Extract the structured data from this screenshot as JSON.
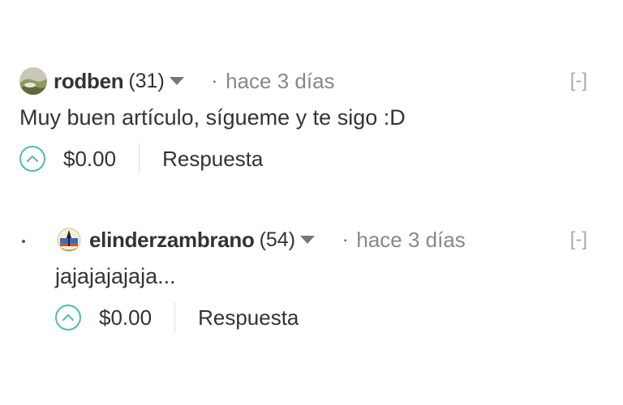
{
  "comments": [
    {
      "author": "rodben",
      "reputation": "(31)",
      "separator": "·",
      "timestamp": "hace 3 días",
      "collapse": "[-]",
      "body": "Muy buen artículo, sígueme y te sigo :D",
      "payout": "$0.00",
      "reply": "Respuesta",
      "avatar_icon": "landscape-avatar-icon"
    },
    {
      "author": "elinderzambrano",
      "reputation": "(54)",
      "separator": "·",
      "timestamp": "hace 3 días",
      "collapse": "[-]",
      "body": "jajajajajaja...",
      "payout": "$0.00",
      "reply": "Respuesta",
      "avatar_icon": "emblem-avatar-icon"
    }
  ],
  "colors": {
    "accent": "#4bc0a0",
    "text": "#333333",
    "muted": "#888888"
  }
}
